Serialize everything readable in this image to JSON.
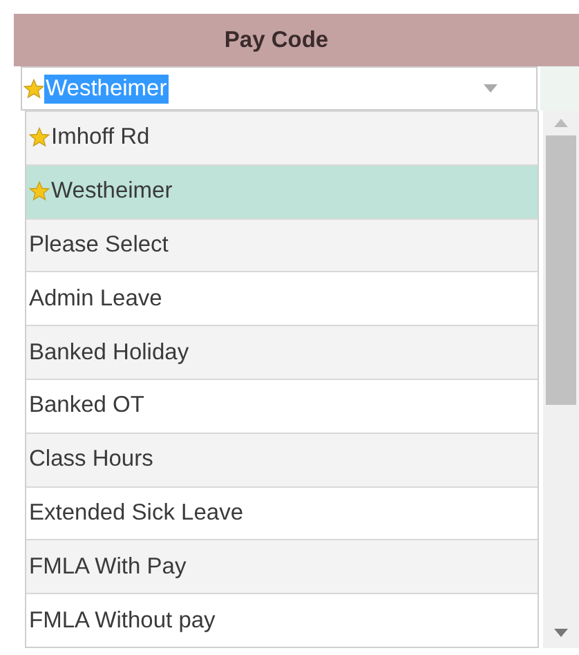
{
  "column_header": "Pay Code",
  "combo": {
    "value": "Westheimer",
    "starred": true,
    "text_selected": true
  },
  "options": [
    {
      "label": "Imhoff Rd",
      "starred": true,
      "selected": false
    },
    {
      "label": "Westheimer",
      "starred": true,
      "selected": true
    },
    {
      "label": "Please Select",
      "starred": false,
      "selected": false
    },
    {
      "label": "Admin Leave",
      "starred": false,
      "selected": false
    },
    {
      "label": "Banked Holiday",
      "starred": false,
      "selected": false
    },
    {
      "label": "Banked OT",
      "starred": false,
      "selected": false
    },
    {
      "label": "Class Hours",
      "starred": false,
      "selected": false
    },
    {
      "label": "Extended Sick Leave",
      "starred": false,
      "selected": false
    },
    {
      "label": "FMLA With Pay",
      "starred": false,
      "selected": false
    },
    {
      "label": "FMLA Without pay",
      "starred": false,
      "selected": false
    }
  ]
}
